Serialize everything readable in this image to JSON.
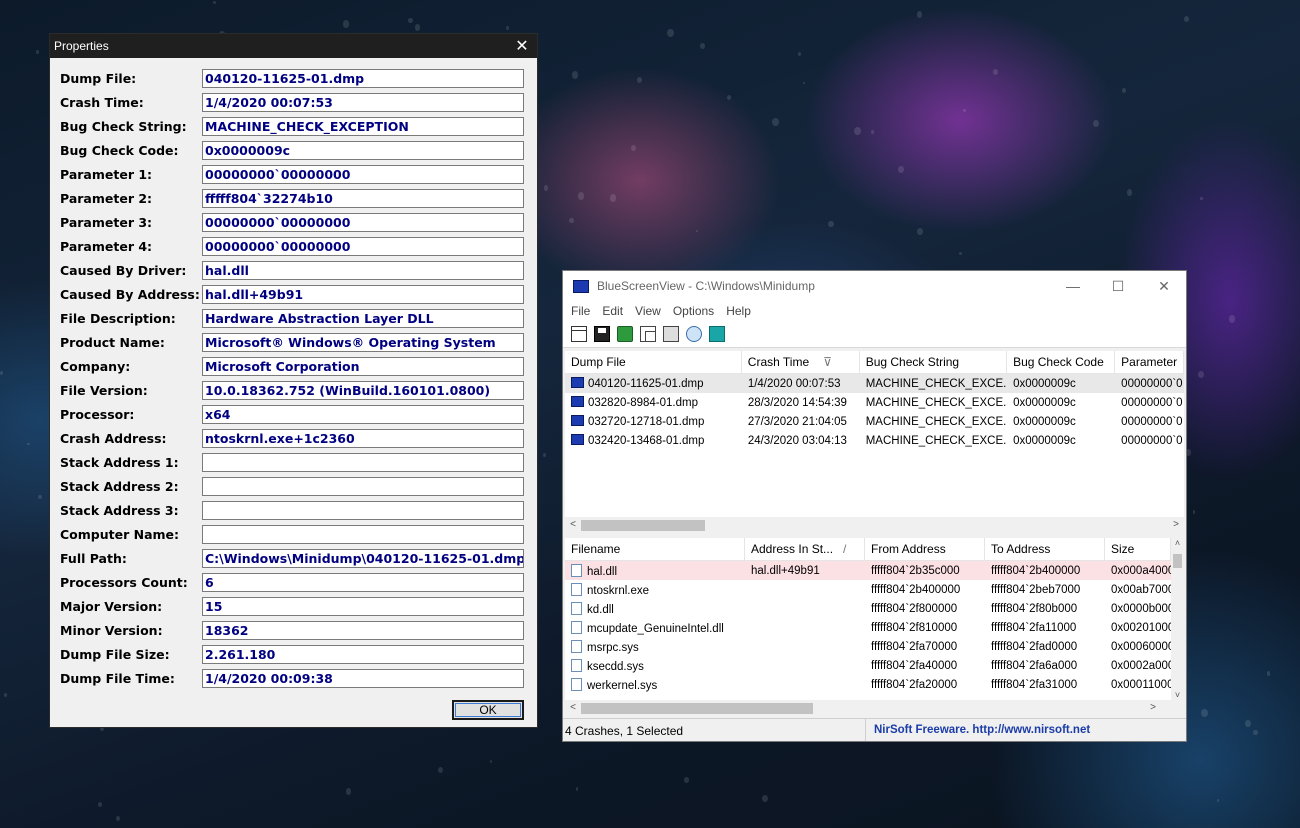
{
  "properties": {
    "title": "Properties",
    "ok_label": "OK",
    "fields": [
      {
        "label": "Dump File:",
        "value": "040120-11625-01.dmp"
      },
      {
        "label": "Crash Time:",
        "value": "1/4/2020 00:07:53"
      },
      {
        "label": "Bug Check String:",
        "value": "MACHINE_CHECK_EXCEPTION"
      },
      {
        "label": "Bug Check Code:",
        "value": "0x0000009c"
      },
      {
        "label": "Parameter 1:",
        "value": "00000000`00000000"
      },
      {
        "label": "Parameter 2:",
        "value": "fffff804`32274b10"
      },
      {
        "label": "Parameter 3:",
        "value": "00000000`00000000"
      },
      {
        "label": "Parameter 4:",
        "value": "00000000`00000000"
      },
      {
        "label": "Caused By Driver:",
        "value": "hal.dll"
      },
      {
        "label": "Caused By Address:",
        "value": "hal.dll+49b91"
      },
      {
        "label": "File Description:",
        "value": "Hardware Abstraction Layer DLL"
      },
      {
        "label": "Product Name:",
        "value": "Microsoft® Windows® Operating System"
      },
      {
        "label": "Company:",
        "value": "Microsoft Corporation"
      },
      {
        "label": "File Version:",
        "value": "10.0.18362.752 (WinBuild.160101.0800)"
      },
      {
        "label": "Processor:",
        "value": "x64"
      },
      {
        "label": "Crash Address:",
        "value": "ntoskrnl.exe+1c2360"
      },
      {
        "label": "Stack Address 1:",
        "value": ""
      },
      {
        "label": "Stack Address 2:",
        "value": ""
      },
      {
        "label": "Stack Address 3:",
        "value": ""
      },
      {
        "label": "Computer Name:",
        "value": ""
      },
      {
        "label": "Full Path:",
        "value": "C:\\Windows\\Minidump\\040120-11625-01.dmp"
      },
      {
        "label": "Processors Count:",
        "value": "6"
      },
      {
        "label": "Major Version:",
        "value": "15"
      },
      {
        "label": "Minor Version:",
        "value": "18362"
      },
      {
        "label": "Dump File Size:",
        "value": "2.261.180"
      },
      {
        "label": "Dump File Time:",
        "value": "1/4/2020 00:09:38"
      }
    ]
  },
  "bsv": {
    "title": "BlueScreenView  -  C:\\Windows\\Minidump",
    "menu": [
      "File",
      "Edit",
      "View",
      "Options",
      "Help"
    ],
    "win_controls": {
      "minimize": "—",
      "maximize": "☐",
      "close": "✕"
    },
    "toolbar_icons": [
      "properties-icon",
      "save-icon",
      "refresh-icon",
      "copy-icon",
      "html-report-icon",
      "find-icon",
      "exit-icon"
    ],
    "dump_columns": [
      "Dump File",
      "Crash Time",
      "Bug Check String",
      "Bug Check Code",
      "Parameter"
    ],
    "sort_indicator": "⊽",
    "dumps": [
      {
        "file": "040120-11625-01.dmp",
        "time": "1/4/2020 00:07:53",
        "string": "MACHINE_CHECK_EXCE...",
        "code": "0x0000009c",
        "param": "00000000`0"
      },
      {
        "file": "032820-8984-01.dmp",
        "time": "28/3/2020 14:54:39",
        "string": "MACHINE_CHECK_EXCE...",
        "code": "0x0000009c",
        "param": "00000000`0"
      },
      {
        "file": "032720-12718-01.dmp",
        "time": "27/3/2020 21:04:05",
        "string": "MACHINE_CHECK_EXCE...",
        "code": "0x0000009c",
        "param": "00000000`0"
      },
      {
        "file": "032420-13468-01.dmp",
        "time": "24/3/2020 03:04:13",
        "string": "MACHINE_CHECK_EXCE...",
        "code": "0x0000009c",
        "param": "00000000`0"
      }
    ],
    "driver_columns": [
      "Filename",
      "Address In St...",
      "From Address",
      "To Address",
      "Size"
    ],
    "driver_sort_indicator": "/",
    "drivers": [
      {
        "name": "hal.dll",
        "addr": "hal.dll+49b91",
        "from": "fffff804`2b35c000",
        "to": "fffff804`2b400000",
        "size": "0x000a4000"
      },
      {
        "name": "ntoskrnl.exe",
        "addr": "",
        "from": "fffff804`2b400000",
        "to": "fffff804`2beb7000",
        "size": "0x00ab7000"
      },
      {
        "name": "kd.dll",
        "addr": "",
        "from": "fffff804`2f800000",
        "to": "fffff804`2f80b000",
        "size": "0x0000b000"
      },
      {
        "name": "mcupdate_GenuineIntel.dll",
        "addr": "",
        "from": "fffff804`2f810000",
        "to": "fffff804`2fa11000",
        "size": "0x00201000"
      },
      {
        "name": "msrpc.sys",
        "addr": "",
        "from": "fffff804`2fa70000",
        "to": "fffff804`2fad0000",
        "size": "0x00060000"
      },
      {
        "name": "ksecdd.sys",
        "addr": "",
        "from": "fffff804`2fa40000",
        "to": "fffff804`2fa6a000",
        "size": "0x0002a000"
      },
      {
        "name": "werkernel.sys",
        "addr": "",
        "from": "fffff804`2fa20000",
        "to": "fffff804`2fa31000",
        "size": "0x00011000"
      }
    ],
    "status": "4 Crashes, 1 Selected",
    "brand": "NirSoft Freeware.  http://www.nirsoft.net"
  }
}
